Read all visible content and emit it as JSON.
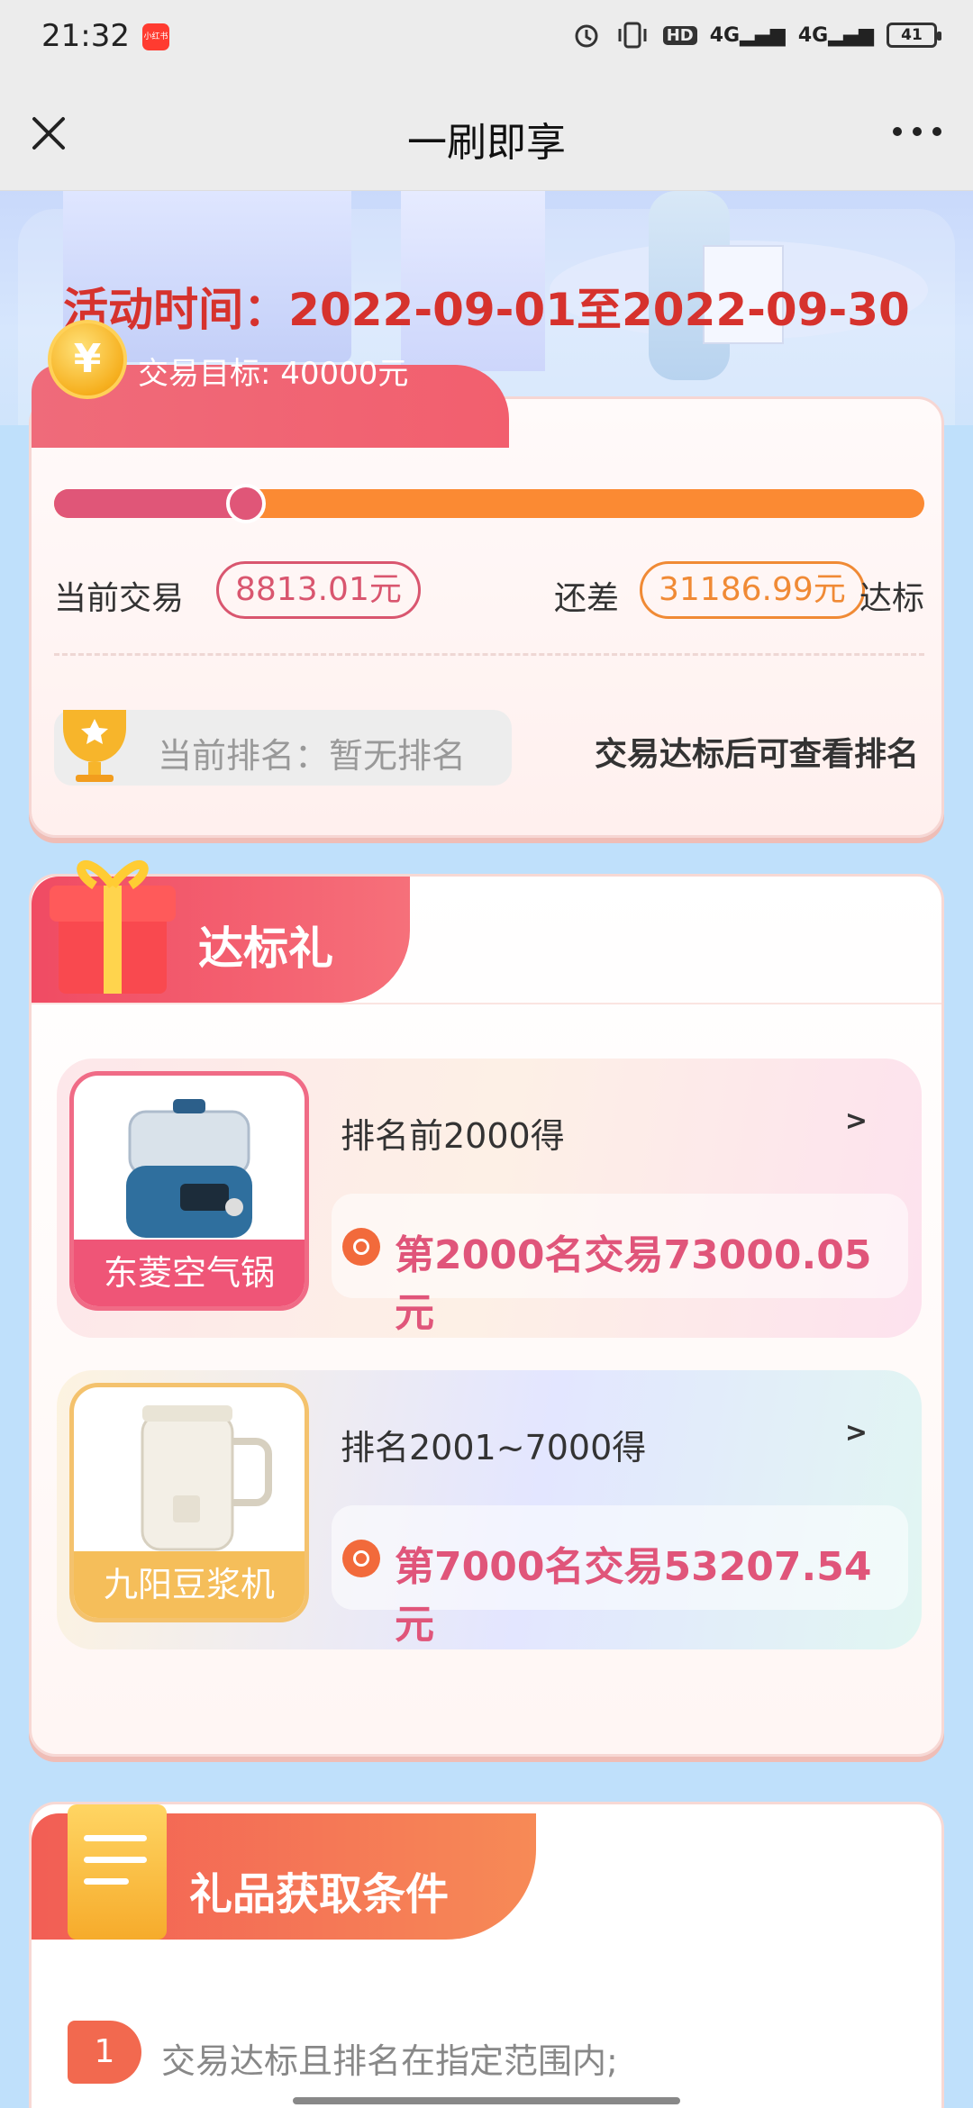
{
  "status_bar": {
    "time": "21:32",
    "app_badge": "小红书",
    "hd_label": "HD",
    "signal1_label": "4G",
    "signal2_label": "4G",
    "battery": "41"
  },
  "nav": {
    "title": "一刷即享"
  },
  "hero": {
    "activity_time": "活动时间：2022-09-01至2022-09-30"
  },
  "goal": {
    "coin_symbol": "¥",
    "target_text": "交易目标: 40000元",
    "progress_fraction": 0.22,
    "current_label": "当前交易",
    "current_value": "8813.01元",
    "diff_label": "还差",
    "diff_value": "31186.99元",
    "diff_suffix": "达标",
    "rank_text": "当前排名：暂无排名",
    "rank_hint": "交易达标后可查看排名"
  },
  "gifts": {
    "title": "达标礼",
    "items": [
      {
        "name": "东菱空气锅",
        "rule": "排名前2000得",
        "arrow": ">",
        "requirement": "第2000名交易73000.05元"
      },
      {
        "name": "九阳豆浆机",
        "rule": "排名2001~7000得",
        "arrow": ">",
        "requirement": "第7000名交易53207.54元"
      }
    ]
  },
  "conditions": {
    "title": "礼品获取条件",
    "items": [
      {
        "num": "1",
        "text": "交易达标且排名在指定范围内;"
      }
    ]
  },
  "colors": {
    "accent_red": "#d6322d",
    "progress_pink": "#e05678",
    "progress_orange": "#fb8a33"
  }
}
